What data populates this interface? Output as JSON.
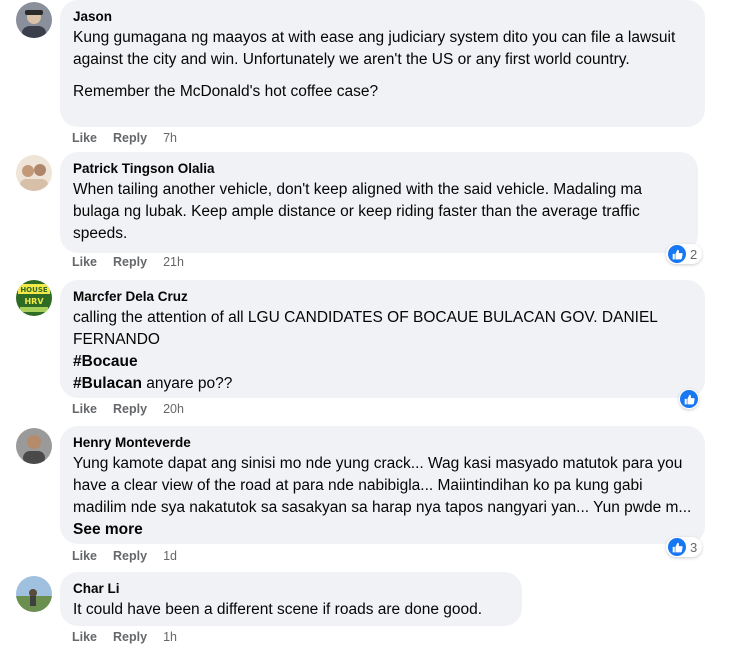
{
  "comments": [
    {
      "author": "Jason",
      "paragraphs": [
        "Kung gumagana ng maayos at with ease ang judiciary system dito you can file a lawsuit against the city and win. Unfortunately we aren't the US or any first world country.",
        "Remember the McDonald's hot coffee case?"
      ],
      "like": "Like",
      "reply": "Reply",
      "time": "7h",
      "avatar_colors": [
        "#6b6f80",
        "#d9c2a8"
      ]
    },
    {
      "author": "Patrick Tingson Olalia",
      "text": "When tailing another vehicle, don't keep aligned with the said vehicle. Madaling ma bulaga ng lubak. Keep ample distance or keep riding faster than the average traffic speeds.",
      "like": "Like",
      "reply": "Reply",
      "time": "21h",
      "reaction_count": "2",
      "avatar_colors": [
        "#e8d6c4",
        "#c29a7a"
      ]
    },
    {
      "author": "Marcfer Dela Cruz",
      "line1": "calling the attention of all LGU CANDIDATES OF BOCAUE BULACAN GOV. DANIEL FERNANDO",
      "hashtag1": "#Bocaue",
      "hashtag2": "#Bulacan",
      "line_end": " anyare po??",
      "like": "Like",
      "reply": "Reply",
      "time": "20h",
      "avatar_text": "HOUSE HRV",
      "avatar_colors": [
        "#3b7a2e",
        "#f2e84a"
      ]
    },
    {
      "author": "Henry Monteverde",
      "text": "Yung kamote dapat ang sinisi mo nde yung crack... Wag kasi masyado matutok para you have a clear view of the road at para nde nabibigla... Maiintindihan ko pa kung gabi madilim nde sya nakatutok sa sasakyan sa harap nya tapos nangyari yan... Yun pwde m...",
      "see_more": "See more",
      "like": "Like",
      "reply": "Reply",
      "time": "1d",
      "reaction_count": "3",
      "avatar_colors": [
        "#5a5a5a",
        "#b58b6a"
      ]
    },
    {
      "author": "Char Li",
      "text": "It could have been a different scene if roads are done good.",
      "like": "Like",
      "reply": "Reply",
      "time": "1h",
      "avatar_colors": [
        "#7fa6c9",
        "#6b8f4f"
      ]
    }
  ],
  "reaction_icon": "thumbs-up-icon",
  "colors": {
    "bubble": "#f0f2f5",
    "meta": "#65676b",
    "like_blue": "#1877f2"
  }
}
